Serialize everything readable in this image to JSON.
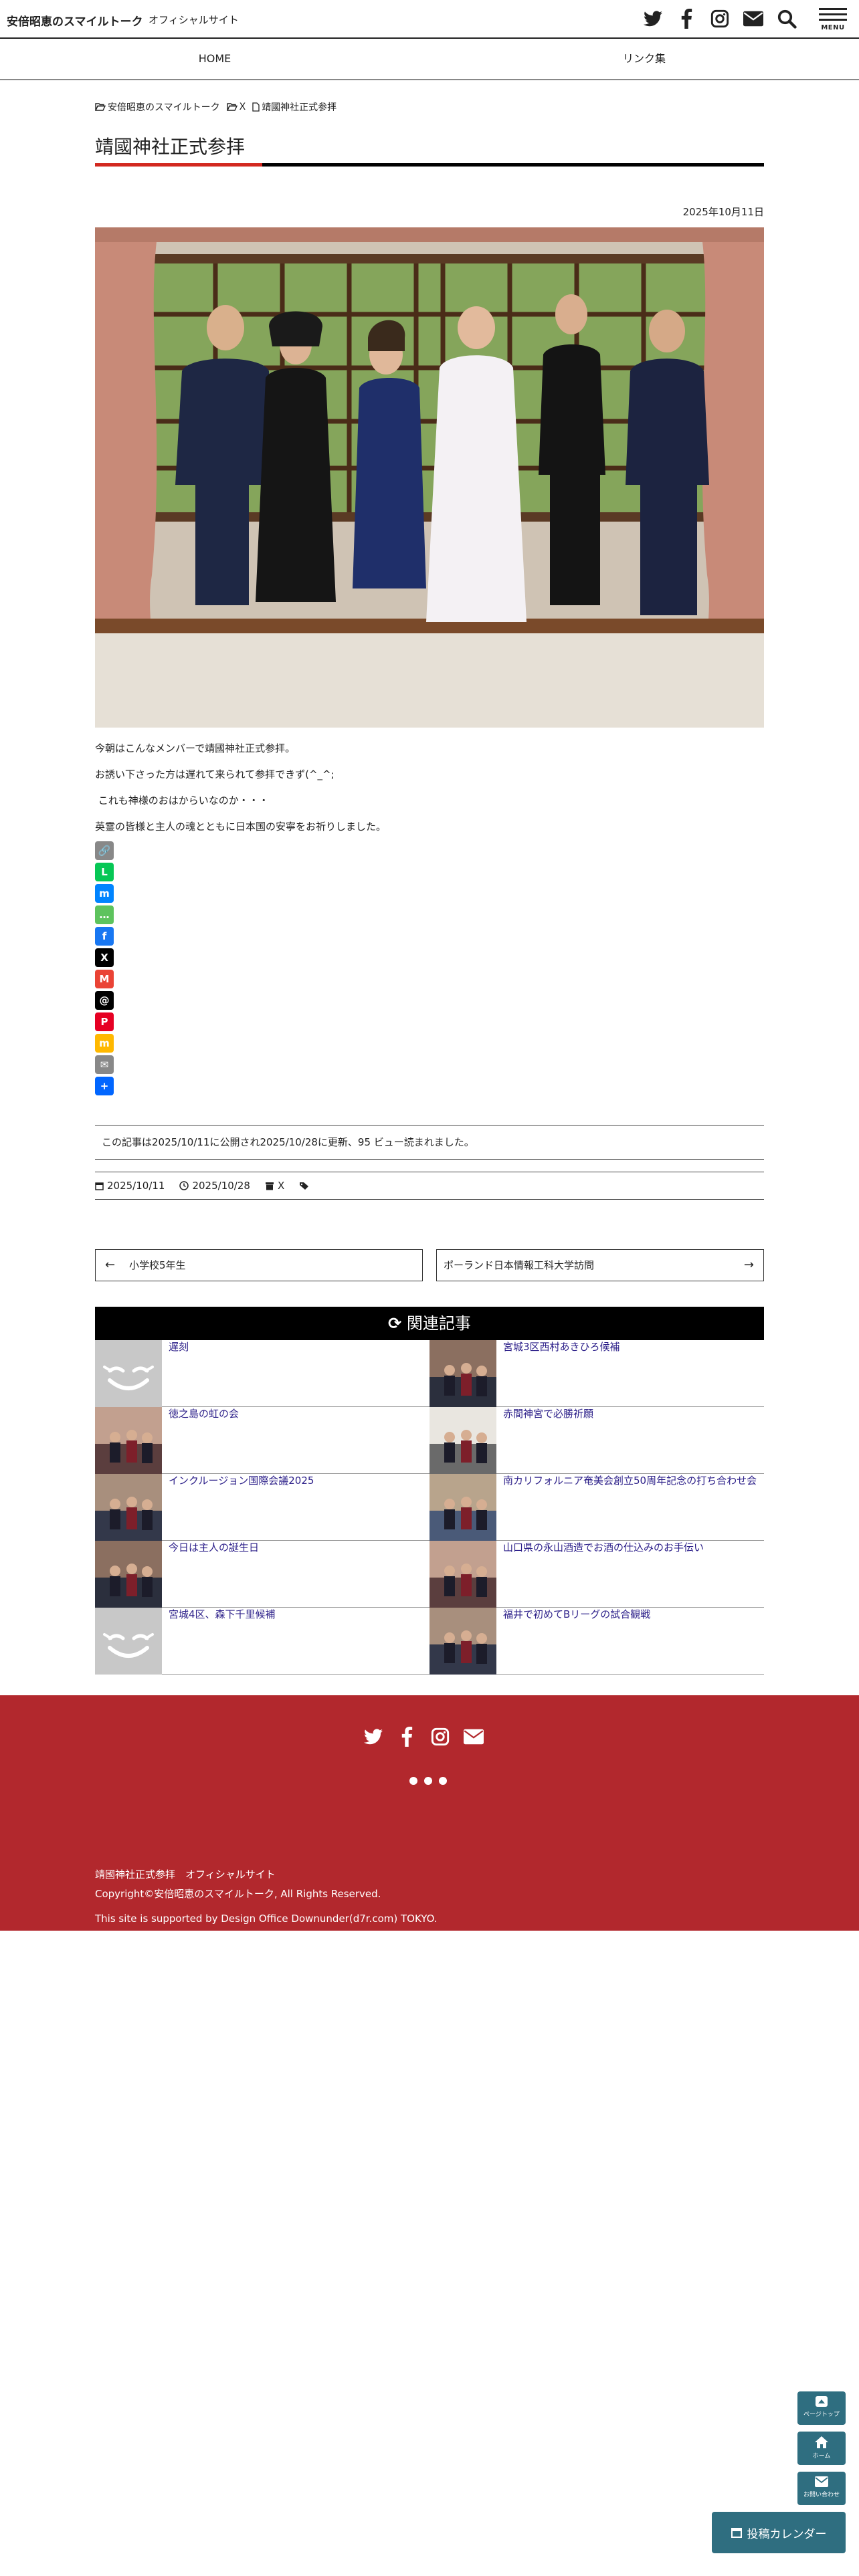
{
  "header": {
    "site_title": "安倍昭恵のスマイルトーク",
    "site_subtitle": "オフィシャルサイト",
    "icons": [
      "twitter-icon",
      "facebook-icon",
      "instagram-icon",
      "mail-icon",
      "search-icon"
    ],
    "menu_label": "MENU"
  },
  "nav": {
    "items": [
      "HOME",
      "リンク集"
    ]
  },
  "breadcrumb": {
    "home": "安倍昭恵のスマイルトーク",
    "category": "X",
    "current": "靖國神社正式参拝"
  },
  "post": {
    "title": "靖國神社正式参拝",
    "date": "2025年10月11日",
    "paragraphs": [
      "今朝はこんなメンバーで靖國神社正式参拝。",
      "お誘い下さった方は遅れて来られて参拝できず(^_^;",
      " これも神様のおはからいなのか・・・",
      "英霊の皆様と主人の魂とともに日本国の安寧をお祈りしました。"
    ]
  },
  "share_buttons": [
    {
      "name": "copy-link",
      "color": "#888888",
      "glyph": "🔗"
    },
    {
      "name": "line",
      "color": "#06c755",
      "glyph": "L"
    },
    {
      "name": "messenger",
      "color": "#0084ff",
      "glyph": "m"
    },
    {
      "name": "sms",
      "color": "#5dc35d",
      "glyph": "…"
    },
    {
      "name": "facebook",
      "color": "#1877f2",
      "glyph": "f"
    },
    {
      "name": "x",
      "color": "#000000",
      "glyph": "X"
    },
    {
      "name": "gmail",
      "color": "#ea4335",
      "glyph": "M"
    },
    {
      "name": "threads",
      "color": "#000000",
      "glyph": "@"
    },
    {
      "name": "pinterest",
      "color": "#e60023",
      "glyph": "P"
    },
    {
      "name": "mix",
      "color": "#ffb800",
      "glyph": "m"
    },
    {
      "name": "email",
      "color": "#888888",
      "glyph": "✉"
    },
    {
      "name": "add-more",
      "color": "#0166ff",
      "glyph": "+"
    }
  ],
  "info_box": "この記事は2025/10/11に公開され2025/10/28に更新、95 ビュー読まれました。",
  "meta": {
    "published": "2025/10/11",
    "updated": "2025/10/28",
    "category": "X"
  },
  "pager": {
    "prev": "小学校5年生",
    "next": "ポーランド日本情報工科大学訪問"
  },
  "related": {
    "heading": "関連記事",
    "items": [
      {
        "title": "遅刻",
        "thumb": "placeholder"
      },
      {
        "title": "宮城3区西村あきひろ候補",
        "thumb": "photo"
      },
      {
        "title": "徳之島の虹の会",
        "thumb": "photo"
      },
      {
        "title": "赤間神宮で必勝祈願",
        "thumb": "photo"
      },
      {
        "title": "インクルージョン国際会議2025",
        "thumb": "photo"
      },
      {
        "title": "南カリフォルニア奄美会創立50周年記念の打ち合わせ会",
        "thumb": "photo"
      },
      {
        "title": "今日は主人の誕生日",
        "thumb": "photo"
      },
      {
        "title": "山口県の永山酒造でお酒の仕込みのお手伝い",
        "thumb": "photo"
      },
      {
        "title": "宮城4区、森下千里候補",
        "thumb": "placeholder"
      },
      {
        "title": "福井で初めてBリーグの試合観戦",
        "thumb": "photo"
      }
    ]
  },
  "footer": {
    "line1": "靖國神社正式参拝　オフィシャルサイト",
    "line2": "Copyright©安倍昭恵のスマイルトーク, All Rights Reserved.",
    "line3": "This site is supported by Design Office Downunder(d7r.com) TOKYO."
  },
  "floating": {
    "page_top": "ページトップ",
    "home": "ホーム",
    "contact": "お問い合わせ",
    "calendar": "投稿カレンダー"
  },
  "colors": {
    "accent_red": "#d2281f",
    "footer_bg": "#b2282d",
    "link": "#2a1d88",
    "float_btn": "#2f6e80"
  }
}
